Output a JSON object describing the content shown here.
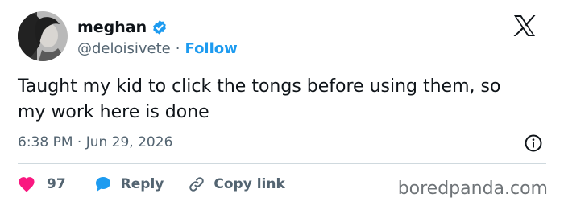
{
  "author": {
    "display_name": "meghan",
    "handle": "@deloisivete",
    "separator": "·",
    "follow_label": "Follow",
    "verified": true
  },
  "tweet": {
    "text": "Taught my kid to click the tongs before using them, so my work here is done",
    "timestamp": "6:38 PM · Jun 29, 2026"
  },
  "actions": {
    "like_count": "97",
    "reply_label": "Reply",
    "copy_label": "Copy link"
  },
  "watermark": "boredpanda.com",
  "colors": {
    "accent": "#1d9bf0",
    "like": "#f91880",
    "muted": "#536471",
    "text": "#0f1419",
    "divider": "#cfd9de"
  },
  "icons": [
    "avatar-photo",
    "verified-badge-icon",
    "x-logo-icon",
    "info-icon",
    "heart-icon",
    "reply-icon",
    "link-icon"
  ]
}
